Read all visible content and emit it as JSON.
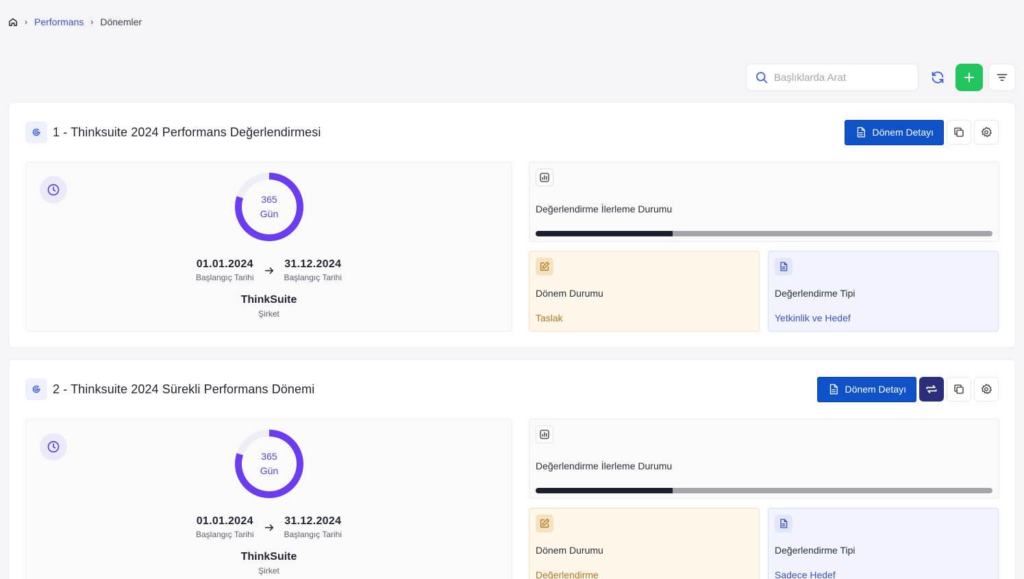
{
  "breadcrumb": {
    "items": [
      "Performans",
      "Dönemler"
    ]
  },
  "search": {
    "placeholder": "Başlıklarda Arat"
  },
  "periods": [
    {
      "title": "1 - Thinksuite 2024 Performans Değerlendirmesi",
      "detail_label": "Dönem Detayı",
      "has_switch": false,
      "days": "365",
      "days_unit": "Gün",
      "ring_fraction": 0.8,
      "start_date": "01.01.2024",
      "start_label": "Başlangıç Tarihi",
      "end_date": "31.12.2024",
      "end_label": "Başlangıç Tarihi",
      "company": "ThinkSuite",
      "company_label": "Şirket",
      "progress_label": "Değerlendirme İlerleme Durumu",
      "progress": 0.3,
      "status_label": "Dönem Durumu",
      "status_value": "Taslak",
      "type_label": "Değerlendirme Tipi",
      "type_value": "Yetkinlik ve Hedef"
    },
    {
      "title": "2 - Thinksuite 2024 Sürekli Performans Dönemi",
      "detail_label": "Dönem Detayı",
      "has_switch": true,
      "days": "365",
      "days_unit": "Gün",
      "ring_fraction": 0.8,
      "start_date": "01.01.2024",
      "start_label": "Başlangıç Tarihi",
      "end_date": "31.12.2024",
      "end_label": "Başlangıç Tarihi",
      "company": "ThinkSuite",
      "company_label": "Şirket",
      "progress_label": "Değerlendirme İlerleme Durumu",
      "progress": 0.3,
      "status_label": "Dönem Durumu",
      "status_value": "Değerlendirme",
      "type_label": "Değerlendirme Tipi",
      "type_value": "Sadece Hedef"
    }
  ],
  "colors": {
    "accent_blue": "#0f52c7",
    "add_green": "#22c55e",
    "ring_purple": "#6a3df0",
    "status_orange": "#b1761e",
    "type_blue": "#3c4fbf"
  },
  "icons": [
    "home-icon",
    "search-icon",
    "refresh-icon",
    "plus-icon",
    "filter-icon",
    "period-icon",
    "document-icon",
    "copy-icon",
    "settings-icon",
    "switch-icon",
    "clock-icon",
    "arrow-right-icon",
    "chart-icon",
    "edit-icon"
  ]
}
